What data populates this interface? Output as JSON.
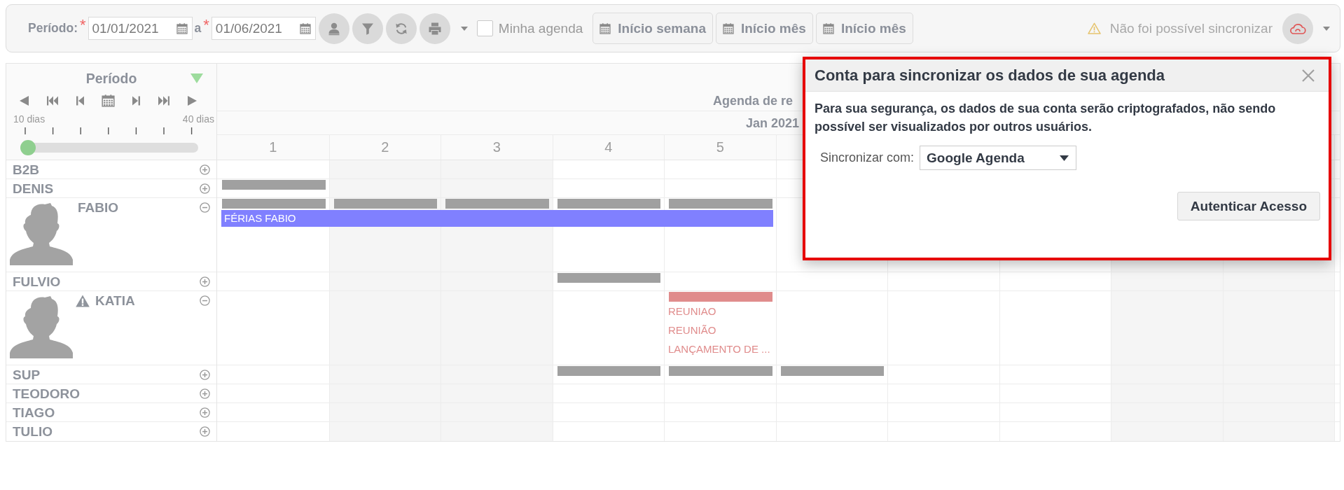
{
  "toolbar": {
    "period_label": "Período:",
    "start_date": {
      "required_mark": "*",
      "value": "01/01/2021"
    },
    "separator": "a",
    "end_date": {
      "required_mark": "*",
      "value": "01/06/2021"
    },
    "my_agenda": {
      "label": "Minha agenda",
      "checked": false
    },
    "range_buttons": [
      "Início semana",
      "Início mês",
      "Início mês"
    ],
    "sync_status": "Não foi possível sincronizar"
  },
  "period_panel": {
    "title": "Período",
    "min_label": "10 dias",
    "max_label": "40 dias",
    "slider": {
      "level": 0
    }
  },
  "calendar": {
    "title": "Agenda de re",
    "month": "Jan 2021",
    "columns": [
      {
        "label": "1",
        "weekend": false
      },
      {
        "label": "2",
        "weekend": true
      },
      {
        "label": "3",
        "weekend": true
      },
      {
        "label": "4",
        "weekend": false
      },
      {
        "label": "5",
        "weekend": false
      },
      {
        "weekend": false
      },
      {
        "weekend": false
      },
      {
        "weekend": false
      },
      {
        "weekend": true
      },
      {
        "weekend": true
      }
    ]
  },
  "resources": [
    {
      "name": "B2B",
      "expanded": false,
      "warning": false,
      "days": [
        {
          "busy": false
        },
        {
          "busy": false
        },
        {
          "busy": false
        },
        {
          "busy": false
        },
        {
          "busy": false
        },
        {
          "busy": false
        }
      ]
    },
    {
      "name": "DENIS",
      "expanded": false,
      "warning": false,
      "days": [
        {
          "busy": true,
          "color": "#a0a0a0"
        },
        {
          "busy": false
        },
        {
          "busy": false
        },
        {
          "busy": false
        },
        {
          "busy": false
        },
        {
          "busy": false
        }
      ]
    },
    {
      "name": "FABIO",
      "expanded": true,
      "warning": false,
      "days": [
        {
          "busy": true,
          "color": "#a0a0a0"
        },
        {
          "busy": true,
          "color": "#a0a0a0"
        },
        {
          "busy": true,
          "color": "#a0a0a0"
        },
        {
          "busy": true,
          "color": "#a0a0a0"
        },
        {
          "busy": true,
          "color": "#a0a0a0"
        },
        {
          "busy": false
        }
      ],
      "span_event": {
        "label": "FÉRIAS FABIO",
        "days": [
          true,
          true,
          true,
          true,
          true,
          false
        ]
      }
    },
    {
      "name": "FULVIO",
      "expanded": false,
      "warning": false,
      "days": [
        {
          "busy": false
        },
        {
          "busy": false
        },
        {
          "busy": false
        },
        {
          "busy": true,
          "color": "#a0a0a0"
        },
        {
          "busy": false
        },
        {
          "busy": false
        },
        {
          "busy": false
        },
        {
          "busy": false
        },
        {
          "busy": false
        },
        {
          "busy": false
        }
      ]
    },
    {
      "name": "KATIA",
      "expanded": true,
      "warning": true,
      "days": [
        {
          "busy": false
        },
        {
          "busy": false
        },
        {
          "busy": false
        },
        {
          "busy": false
        },
        {
          "busy": true,
          "color": "#e08c8c",
          "events": [
            "REUNIAO",
            "REUNIÃO",
            "LANÇAMENTO DE ..."
          ]
        },
        {
          "busy": false
        },
        {
          "busy": false
        },
        {
          "busy": false
        },
        {
          "busy": false
        },
        {
          "busy": false
        }
      ]
    },
    {
      "name": "SUP",
      "expanded": false,
      "warning": false,
      "days": [
        {
          "busy": false
        },
        {
          "busy": false
        },
        {
          "busy": false
        },
        {
          "busy": true,
          "color": "#a0a0a0"
        },
        {
          "busy": true,
          "color": "#a0a0a0"
        },
        {
          "busy": true,
          "color": "#a0a0a0"
        },
        {
          "busy": false
        },
        {
          "busy": false
        },
        {
          "busy": false
        },
        {
          "busy": false
        }
      ]
    },
    {
      "name": "TEODORO",
      "expanded": false,
      "warning": false,
      "days": [
        {
          "busy": false
        },
        {
          "busy": false
        },
        {
          "busy": false
        },
        {
          "busy": false
        },
        {
          "busy": false
        },
        {
          "busy": false
        },
        {
          "busy": false
        },
        {
          "busy": false
        },
        {
          "busy": false
        },
        {
          "busy": false
        }
      ]
    },
    {
      "name": "TIAGO",
      "expanded": false,
      "warning": false,
      "days": [
        {
          "busy": false
        },
        {
          "busy": false
        },
        {
          "busy": false
        },
        {
          "busy": false
        },
        {
          "busy": false
        },
        {
          "busy": false
        },
        {
          "busy": false
        },
        {
          "busy": false
        },
        {
          "busy": false
        },
        {
          "busy": false
        }
      ]
    },
    {
      "name": "TULIO",
      "expanded": false,
      "warning": false,
      "days": [
        {
          "busy": false
        },
        {
          "busy": false
        },
        {
          "busy": false
        },
        {
          "busy": false
        },
        {
          "busy": false
        },
        {
          "busy": false
        },
        {
          "busy": false
        },
        {
          "busy": false
        },
        {
          "busy": false
        },
        {
          "busy": false
        }
      ]
    }
  ],
  "sync_dialog": {
    "highlighted": true,
    "title": "Conta para sincronizar os dados de sua agenda",
    "message": "Para sua segurança, os dados de sua conta serão criptografados, não sendo possível ser visualizados por outros usuários.",
    "sync_label": "Sincronizar com:",
    "sync_value": "Google Agenda",
    "button": "Autenticar Acesso"
  }
}
